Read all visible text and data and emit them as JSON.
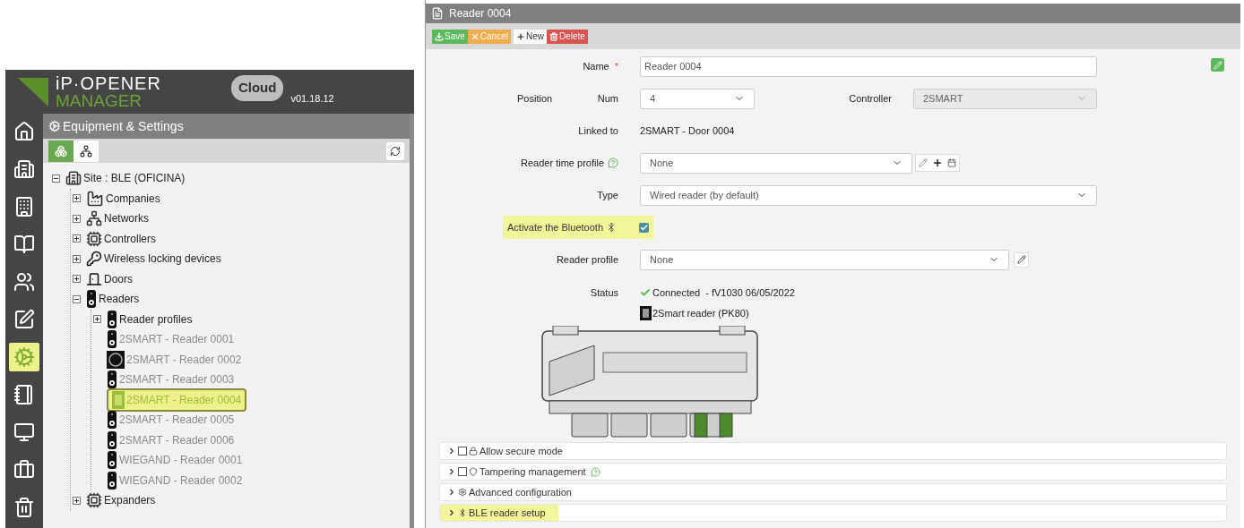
{
  "app": {
    "logo_top": "iP·OPENER",
    "logo_bottom": "MANAGER",
    "cloud": "Cloud",
    "version": "v01.18.12"
  },
  "nav": [
    {
      "selected": false
    },
    {
      "selected": false
    },
    {
      "selected": false
    },
    {
      "selected": false
    },
    {
      "selected": false
    },
    {
      "selected": false
    },
    {
      "selected": true
    },
    {
      "selected": false
    },
    {
      "selected": false
    },
    {
      "selected": false
    },
    {
      "selected": false
    }
  ],
  "panel": {
    "title": "Equipment & Settings",
    "views": [
      {
        "selected": true
      },
      {
        "selected": false
      }
    ]
  },
  "tree": [
    {
      "label": "Site : BLE (OFICINA)",
      "kind": "site",
      "expanded": true,
      "selected": false,
      "muted": false,
      "children": [
        {
          "label": "Companies",
          "kind": "factory",
          "expanded": false,
          "selected": false,
          "muted": false
        },
        {
          "label": "Networks",
          "kind": "network",
          "expanded": false,
          "selected": false,
          "muted": false
        },
        {
          "label": "Controllers",
          "kind": "controller",
          "expanded": false,
          "selected": false,
          "muted": false
        },
        {
          "label": "Wireless locking devices",
          "kind": "lock",
          "expanded": false,
          "selected": false,
          "muted": false
        },
        {
          "label": "Doors",
          "kind": "door",
          "expanded": false,
          "selected": false,
          "muted": false
        },
        {
          "label": "Readers",
          "kind": "reader",
          "expanded": true,
          "selected": false,
          "muted": false,
          "children": [
            {
              "label": "Reader profiles",
              "kind": "reader",
              "expanded": false,
              "selected": false,
              "muted": false
            },
            {
              "label": "2SMART - Reader 0001",
              "kind": "reader",
              "selected": false,
              "muted": true
            },
            {
              "label": "2SMART - Reader 0002",
              "kind": "round-reader",
              "selected": false,
              "muted": true
            },
            {
              "label": "2SMART - Reader 0003",
              "kind": "reader",
              "selected": false,
              "muted": true
            },
            {
              "label": "2SMART - Reader 0004",
              "kind": "keypad",
              "selected": true,
              "muted": true
            },
            {
              "label": "2SMART - Reader 0005",
              "kind": "reader",
              "selected": false,
              "muted": true
            },
            {
              "label": "2SMART - Reader 0006",
              "kind": "reader",
              "selected": false,
              "muted": true
            },
            {
              "label": "WIEGAND - Reader 0001",
              "kind": "reader",
              "selected": false,
              "muted": true
            },
            {
              "label": "WIEGAND - Reader 0002",
              "kind": "reader",
              "selected": false,
              "muted": true
            }
          ]
        },
        {
          "label": "Expanders",
          "kind": "controller",
          "expanded": false,
          "selected": false,
          "muted": false
        }
      ]
    }
  ],
  "form": {
    "title": "Reader 0004",
    "actions": [
      {
        "label": "Save",
        "kind": "save"
      },
      {
        "label": "Cancel",
        "kind": "cancel"
      },
      {
        "label": "New",
        "kind": "new"
      },
      {
        "label": "Delete",
        "kind": "delete"
      }
    ],
    "name": {
      "label": "Name",
      "required_mark": "*",
      "value": "Reader 0004"
    },
    "position": {
      "label": "Position",
      "num_label": "Num",
      "num": "4",
      "controller_label": "Controller",
      "controller": "2SMART",
      "controller_disabled": true
    },
    "linked_to": {
      "label": "Linked to",
      "value": "2SMART - Door 0004"
    },
    "time_profile": {
      "label": "Reader time profile",
      "value": "None"
    },
    "type": {
      "label": "Type",
      "value": "Wired reader (by default)"
    },
    "bluetooth": {
      "label": "Activate the Bluetooth",
      "checked": true,
      "highlighted": true
    },
    "reader_profile": {
      "label": "Reader profile",
      "value": "None"
    },
    "status": {
      "label": "Status",
      "state": "Connected",
      "firmware": "- fV1030 06/05/2022",
      "device": "2Smart reader (PK80)"
    },
    "sections": [
      {
        "label": "Allow secure mode",
        "kind": "lock",
        "checked": false,
        "highlighted": false
      },
      {
        "label": "Tampering management",
        "kind": "shield",
        "checked": false,
        "help": true,
        "highlighted": false
      },
      {
        "label": "Advanced configuration",
        "kind": "gear",
        "highlighted": false
      },
      {
        "label": "BLE reader setup",
        "kind": "bluetooth",
        "highlighted": true
      }
    ]
  }
}
